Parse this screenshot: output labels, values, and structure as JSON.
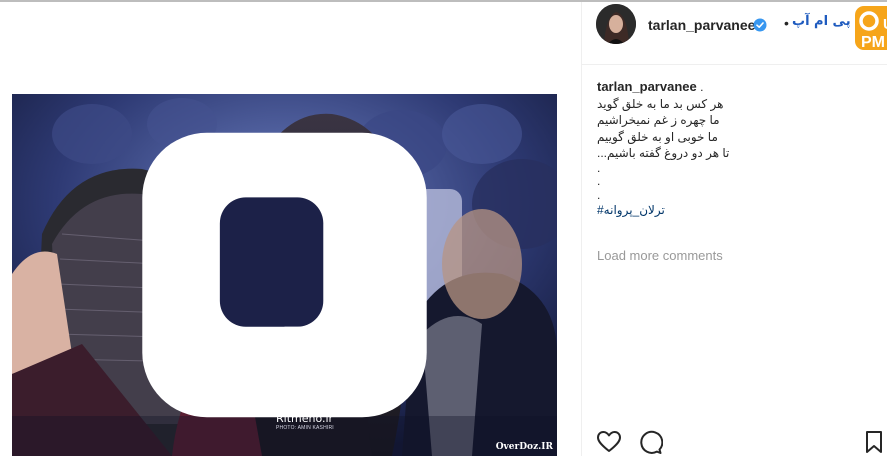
{
  "post": {
    "username": "tarlan_parvanee",
    "verified": true,
    "header_separator": "•",
    "site_logo_text": "پی ام آپ",
    "badge_text": "PM UP"
  },
  "caption": {
    "author": "tarlan_parvanee",
    "author_suffix": ".",
    "lines": [
      "هر کس بد ما به خلق گوید",
      "ما چهره ز غم نمیخراشیم",
      "ما خوبی او به خلق گوییم",
      "تا هر دو دروغ گفته باشیم..."
    ],
    "dots": [
      ".",
      ".",
      "."
    ],
    "hashtag": "ترلان_پروانه#"
  },
  "comments": {
    "load_more_label": "Load more comments"
  },
  "photo": {
    "watermark_text": "Ritmeno.ir",
    "watermark_subtext": "PHOTO: AMIN KASHIRI",
    "corner_watermark": "OverDoz.IR"
  },
  "actions": {
    "like_icon": "heart-outline-icon",
    "comment_icon": "comment-bubble-icon",
    "save_icon": "bookmark-outline-icon"
  },
  "colors": {
    "text": "#262626",
    "muted": "#999999",
    "hashtag": "#003569",
    "verified": "#3897f0",
    "brand_badge": "#f6a51a"
  }
}
